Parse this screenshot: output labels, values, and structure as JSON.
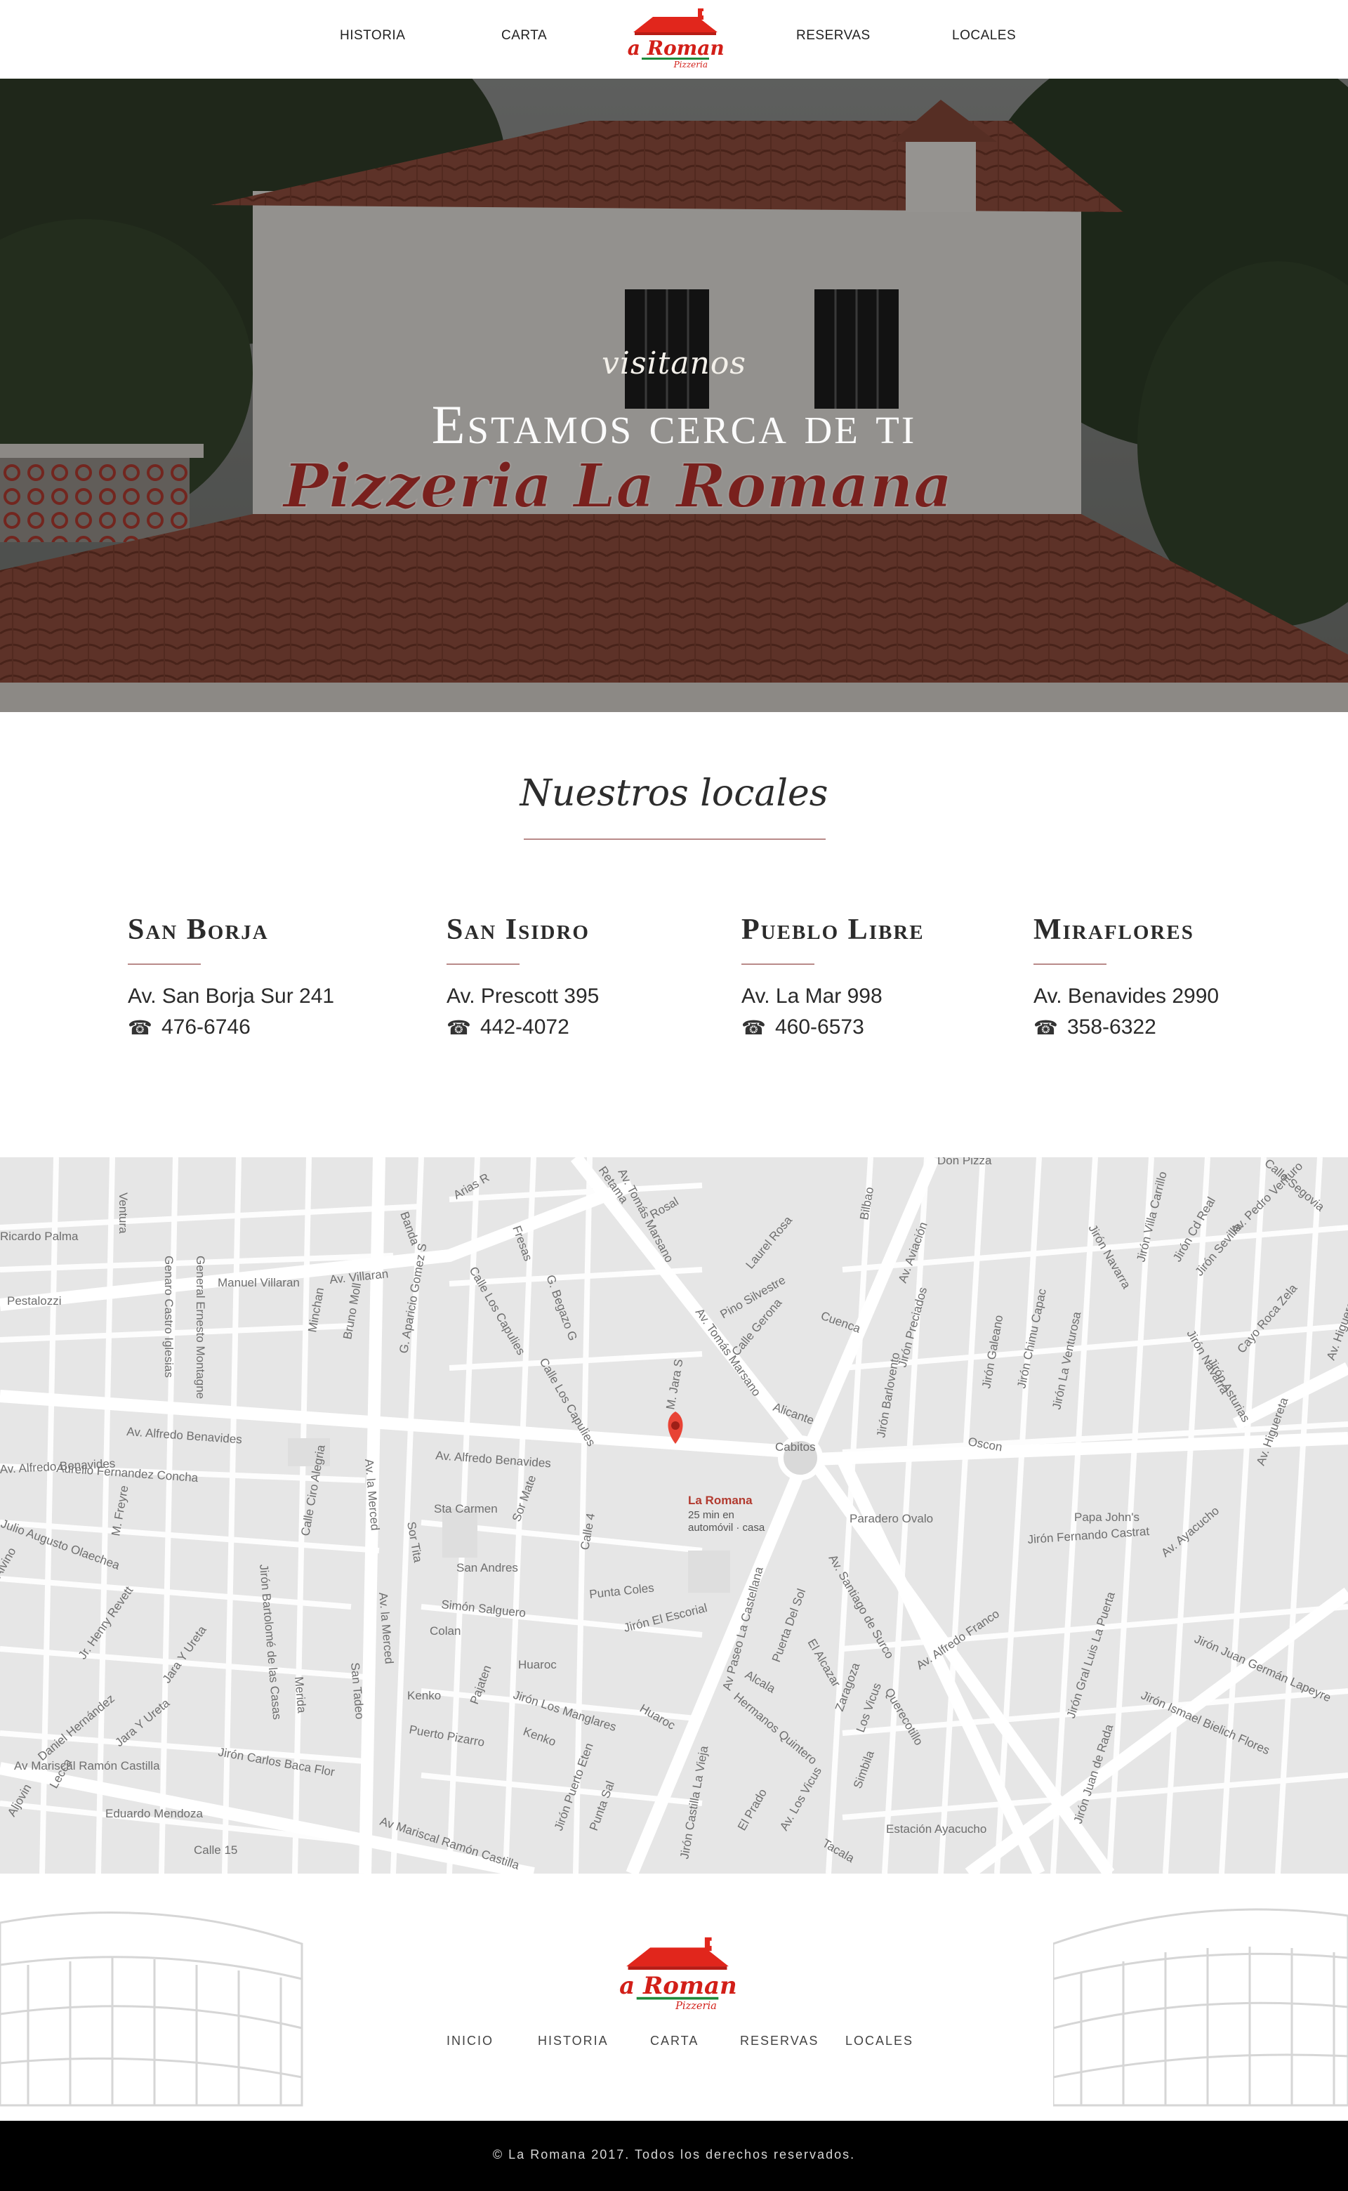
{
  "header": {
    "nav_left": [
      "HISTORIA",
      "CARTA"
    ],
    "nav_right": [
      "RESERVAS",
      "LOCALES"
    ],
    "logo": {
      "brand": "La Romana",
      "sub": "Pizzeria",
      "roof_color": "#e1261c"
    }
  },
  "hero": {
    "subtitle": "visitanos",
    "title": "Estamos cerca de ti",
    "sign_text": "Pizzeria La Romana"
  },
  "locales": {
    "title": "Nuestros locales",
    "accent_color": "#b98b89",
    "items": [
      {
        "name": "San Borja",
        "address": "Av. San Borja Sur 241",
        "phone": "476-6746",
        "icon": "phone-icon"
      },
      {
        "name": "San Isidro",
        "address": "Av. Prescott 395",
        "phone": "442-4072",
        "icon": "phone-icon"
      },
      {
        "name": "Pueblo Libre",
        "address": "Av. La Mar 998",
        "phone": "460-6573",
        "icon": "phone-icon"
      },
      {
        "name": "Miraflores",
        "address": "Av. Benavides 2990",
        "phone": "358-6322",
        "icon": "phone-icon"
      }
    ]
  },
  "map": {
    "marker_title": "La Romana",
    "marker_note_1": "25 min en",
    "marker_note_2": "automóvil · casa",
    "pin_color": "#e84335",
    "labels": {
      "don_pizza": "Don Pizza",
      "papa_johns": "Papa John's",
      "paradero_ovalo": "Paradero Ovalo",
      "estacion_ayacucho": "Estación Ayacucho",
      "cabitos": "Cabitos",
      "av_alfredo_benavides_1": "Av. Alfredo Benavides",
      "av_alfredo_benavides_2": "Av. Alfredo Benavides",
      "av_alfredo_benavides_3": "Av. Alfredo Benavides",
      "av_tomas_marsano": "Av. Tomás Marsano",
      "av_tomas_marsano_2": "Av. Tomás Marsano",
      "av_mariscal_castilla": "Av Mariscal Ramón Castilla",
      "av_mariscal_castilla_2": "Av Mariscal Ramón Castilla",
      "manuel_villaran": "Manuel Villaran",
      "av_villaran": "Av. Villaran",
      "jiron_fernando_castrat": "Jirón Fernando Castrat",
      "av_paseo_castellana": "Av Paseo La Castellana",
      "av_santiago_surco": "Av. Santiago de Surco",
      "av_la_merced": "Av. la Merced",
      "av_la_merced_2": "Av. la Merced",
      "jiron_los_manglares": "Jirón Los Manglares",
      "eduardo_mendoza": "Eduardo Mendoza",
      "calle_15": "Calle 15",
      "jiron_carlos_baca_flor": "Jirón Carlos Baca Flor",
      "aurelio_fernandez_concha": "Aurelio Fernandez Concha",
      "sta_carmen": "Sta Carmen",
      "san_andres": "San Andres",
      "simon_salguero": "Simón Salguero",
      "colan": "Colan",
      "huaroc": "Huaroc",
      "huaroc_2": "Huaroc",
      "kenko": "Kenko",
      "kenko_2": "Kenko",
      "puerto_pizarro": "Puerto Pizarro",
      "punta_coles": "Punta Coles",
      "jiron_el_escorial": "Jirón El Escorial",
      "alicante": "Alicante",
      "oscon": "Oscon",
      "pino_silvestre": "Pino Silvestre",
      "laurel_rosa": "Laurel Rosa",
      "rosal": "Rosal",
      "retama": "Retama",
      "cuenca": "Cuenca",
      "calle_gerona": "Calle Gerona",
      "pestalozzi": "Pestalozzi",
      "ricardo_palma": "Ricardo Palma",
      "av_alfredo_franco": "Av. Alfredo Franco",
      "jiron_juan_german_lapeyre": "Jirón Juan Germán Lapeyre",
      "jiron_ismael_bielich_flores": "Jirón Ismael Bielich Flores",
      "av_ayacucho": "Av. Ayacucho",
      "jr_henry_revett": "Jr. Henry Revett",
      "jara_y_ureta": "Jara Y Ureta",
      "jara_y_ureta_2": "Jara Y Ureta",
      "daniel_hernandez": "Daniel Hernández",
      "av_mariscal_ramon_castilla_w": "Av Mariscal Ramón Castilla",
      "julio_augusto_olaechea": "Julio Augusto Olaechea",
      "genaro_castro_iglesias": "Genaro Castro Iglesias",
      "general_ernesto_montagne": "General Ernesto Montagne",
      "minchan": "Minchan",
      "bruno_moll": "Bruno Moll",
      "g_aparicio_gomez": "G. Aparicio Gomez S",
      "calle_los_capulies": "Calle Los Capulies",
      "calle_los_capulies_2": "Calle Los Capulies",
      "sor_mate": "Sor Mate",
      "sor_tita": "Sor Tita",
      "calle_4": "Calle 4",
      "calle_ciro_alegria": "Calle Ciro Alegria",
      "jiron_bartolome_casas": "Jirón Bartolomé de las Casas",
      "merida": "Merida",
      "san_tadeo": "San Tadeo",
      "arias_r": "Arias R",
      "banda": "Banda",
      "fresas": "Fresas",
      "g_begazo": "G. Begazo G",
      "bilbao": "Bilbao",
      "av_aviacion": "Av. Aviación",
      "jiron_preciados": "Jirón Preciados",
      "jiron_barlovento": "Jirón Barlovento",
      "jiron_galeano": "Jirón Galeano",
      "jiron_chimu_capac": "Jirón Chimu Capac",
      "jiron_la_venturosa": "Jirón La Venturosa",
      "jiron_navarra": "Jirón Navarra",
      "jiron_villa_carrillo": "Jirón Villa Carrillo",
      "jiron_cd_real": "Jirón Cd Real",
      "jiron_sevilla": "Jirón Sevilla",
      "av_pedro_venturo": "Av. Pedro Venturo",
      "calle_segovia": "Calle Segovia",
      "jiron_asturias": "Jirón Asturias",
      "cayo_roca_zela": "Cayo Roca Zela",
      "av_higuereta": "Av. Higuereta",
      "av_higuereta_2": "Av. Higuereta",
      "jiron_navarra_2": "Jirón Navarra",
      "jiron_gral_luis_la_puerta": "Jirón Gral Luis La Puerta",
      "jiron_juan_de_rada": "Jirón Juan de Rada",
      "alcala": "Alcala",
      "hermanos_quintero": "Hermanos Quintero",
      "puerta_del_sol": "Puerta Del Sol",
      "el_alcazar": "El Alcazar",
      "zaragoza": "Zaragoza",
      "los_vicus": "Los Vicus",
      "los_vicus_2": "Av. Los Vicus",
      "quero_cotillo": "Querecotillo",
      "simbila": "Simbila",
      "tacala": "Tacala",
      "el_prado": "El Prado",
      "jiron_castilla_la_vieja": "Jirón Castilla La Vieja",
      "punta_sal": "Punta Sal",
      "jiron_puerto_eten": "Jirón Puerto Eten",
      "pajaten": "Pajaten",
      "m_jara_s": "M. Jara S",
      "m_freyre": "M. Freyre",
      "ventura": "Ventura",
      "m_alvino": "Alvino",
      "lecca": "Lecca",
      "aljovin": "Aljovin"
    }
  },
  "footer": {
    "logo": {
      "brand": "La Romana",
      "sub": "Pizzeria"
    },
    "nav": [
      "INICIO",
      "HISTORIA",
      "CARTA",
      "RESERVAS",
      "LOCALES"
    ],
    "copyright": "© La Romana 2017. Todos los derechos reservados."
  }
}
